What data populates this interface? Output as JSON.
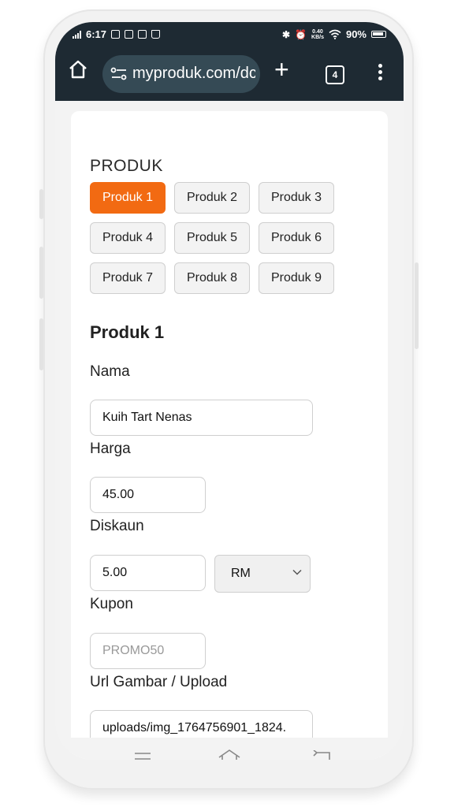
{
  "status_bar": {
    "time": "6:17",
    "net_speed_value": "0.40",
    "net_speed_unit": "KB/s",
    "battery": "90%"
  },
  "browser": {
    "url": "myproduk.com/dc",
    "tab_count": "4"
  },
  "page": {
    "section_title": "PRODUK",
    "products": [
      "Produk 1",
      "Produk 2",
      "Produk 3",
      "Produk 4",
      "Produk 5",
      "Produk 6",
      "Produk 7",
      "Produk 8",
      "Produk 9"
    ],
    "active_product_index": 0,
    "heading": "Produk 1",
    "nama_label": "Nama",
    "nama_value": "Kuih Tart Nenas",
    "harga_label": "Harga",
    "harga_value": "45.00",
    "diskaun_label": "Diskaun",
    "diskaun_value": "5.00",
    "diskaun_unit": "RM",
    "kupon_label": "Kupon",
    "kupon_placeholder": "PROMO50",
    "url_label": "Url Gambar / Upload",
    "url_value": "uploads/img_1764756901_1824."
  },
  "colors": {
    "accent": "#f26a12",
    "toolbar": "#1e2a33",
    "urlbar": "#354a55"
  }
}
